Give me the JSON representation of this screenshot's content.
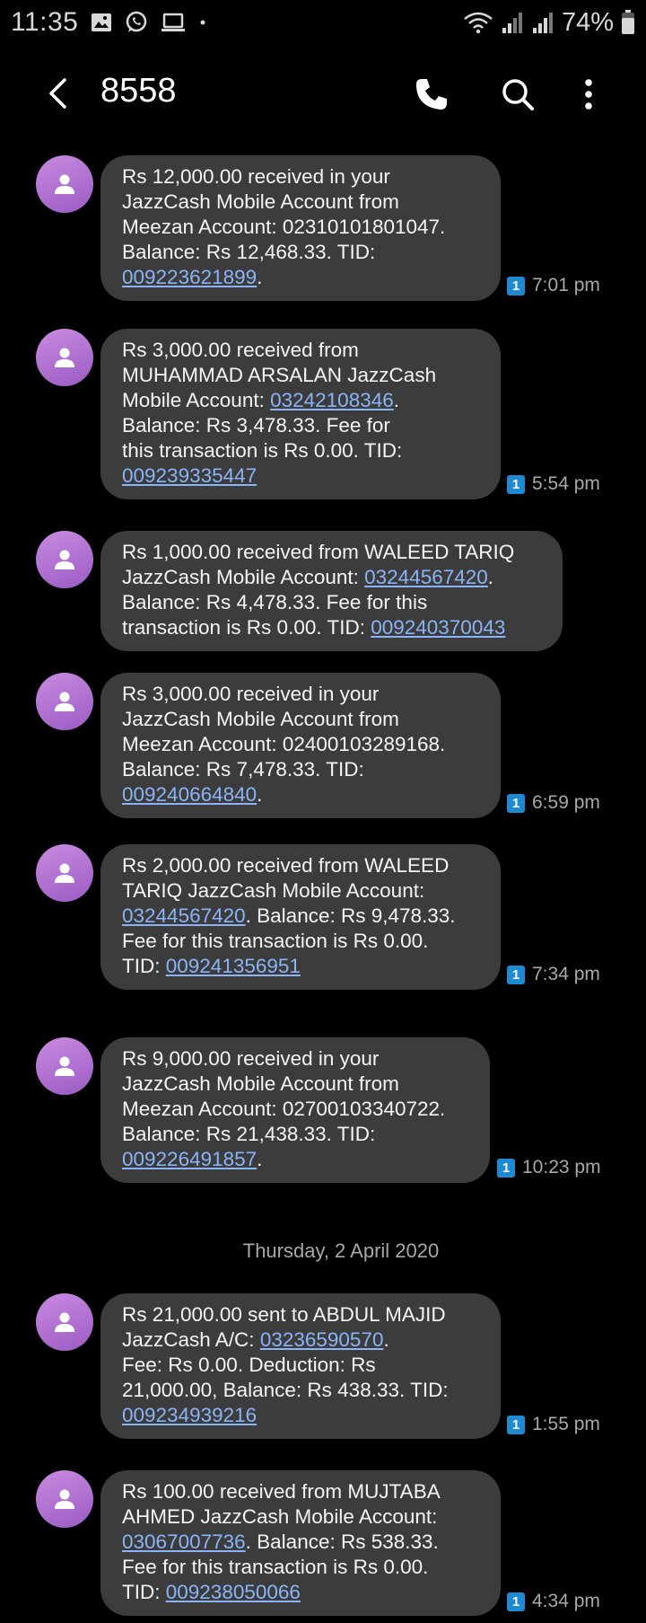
{
  "status_bar": {
    "time": "11:35",
    "battery": "74%",
    "notification_icons": [
      "image-icon",
      "whatsapp-icon",
      "laptop-icon",
      "dot-icon"
    ]
  },
  "header": {
    "title": "8558",
    "actions": [
      "back-icon",
      "phone-icon",
      "search-icon",
      "more-icon"
    ]
  },
  "sim_label": "1",
  "messages": [
    {
      "lines": [
        [
          {
            "t": "Rs 12,000.00 received in your"
          }
        ],
        [
          {
            "t": "JazzCash Mobile Account from"
          }
        ],
        [
          {
            "t": "Meezan Account: 02310101801047."
          }
        ],
        [
          {
            "t": "Balance: Rs 12,468.33. TID:"
          }
        ],
        [
          {
            "t": "009223621899",
            "link": true
          },
          {
            "t": "."
          }
        ]
      ],
      "time": "7:01 pm"
    },
    {
      "lines": [
        [
          {
            "t": "Rs 3,000.00 received from"
          }
        ],
        [
          {
            "t": "MUHAMMAD ARSALAN JazzCash"
          }
        ],
        [
          {
            "t": "Mobile Account: "
          },
          {
            "t": "03242108346",
            "link": true
          },
          {
            "t": "."
          }
        ],
        [
          {
            "t": "Balance: Rs 3,478.33. Fee for"
          }
        ],
        [
          {
            "t": "this transaction is Rs 0.00.  TID:"
          }
        ],
        [
          {
            "t": "009239335447",
            "link": true
          }
        ]
      ],
      "time": "5:54 pm"
    },
    {
      "lines": [
        [
          {
            "t": "Rs 1,000.00 received from WALEED TARIQ"
          }
        ],
        [
          {
            "t": "JazzCash Mobile Account: "
          },
          {
            "t": "03244567420",
            "link": true
          },
          {
            "t": "."
          }
        ],
        [
          {
            "t": "Balance: Rs 4,478.33. Fee for this"
          }
        ],
        [
          {
            "t": "transaction is Rs 0.00.  TID: "
          },
          {
            "t": "009240370043",
            "link": true
          }
        ]
      ],
      "time": ""
    },
    {
      "lines": [
        [
          {
            "t": "Rs 3,000.00 received in your"
          }
        ],
        [
          {
            "t": "JazzCash Mobile Account from"
          }
        ],
        [
          {
            "t": "Meezan Account: 02400103289168."
          }
        ],
        [
          {
            "t": "Balance: Rs 7,478.33. TID:"
          }
        ],
        [
          {
            "t": "009240664840",
            "link": true
          },
          {
            "t": "."
          }
        ]
      ],
      "time": "6:59 pm"
    },
    {
      "lines": [
        [
          {
            "t": "Rs 2,000.00 received from WALEED"
          }
        ],
        [
          {
            "t": "TARIQ JazzCash Mobile Account:"
          }
        ],
        [
          {
            "t": "03244567420",
            "link": true
          },
          {
            "t": ". Balance: Rs 9,478.33."
          }
        ],
        [
          {
            "t": "Fee for this transaction is Rs 0.00."
          }
        ],
        [
          {
            "t": "TID: "
          },
          {
            "t": "009241356951",
            "link": true
          }
        ]
      ],
      "time": "7:34 pm"
    },
    {
      "lines": [
        [
          {
            "t": "Rs 9,000.00 received in your"
          }
        ],
        [
          {
            "t": "JazzCash Mobile Account from"
          }
        ],
        [
          {
            "t": "Meezan Account: 02700103340722."
          }
        ],
        [
          {
            "t": "Balance: Rs 21,438.33. TID:"
          }
        ],
        [
          {
            "t": "009226491857",
            "link": true
          },
          {
            "t": "."
          }
        ]
      ],
      "time": "10:23 pm"
    },
    {
      "lines": [
        [
          {
            "t": "Rs 21,000.00 sent to ABDUL MAJID"
          }
        ],
        [
          {
            "t": "JazzCash A/C: "
          },
          {
            "t": "03236590570",
            "link": true
          },
          {
            "t": "."
          }
        ],
        [
          {
            "t": "Fee: Rs 0.00. Deduction: Rs"
          }
        ],
        [
          {
            "t": "21,000.00, Balance: Rs 438.33. TID:"
          }
        ],
        [
          {
            "t": "009234939216",
            "link": true
          }
        ]
      ],
      "time": "1:55 pm"
    },
    {
      "lines": [
        [
          {
            "t": "Rs 100.00 received from MUJTABA"
          }
        ],
        [
          {
            "t": "AHMED JazzCash Mobile Account:"
          }
        ],
        [
          {
            "t": "03067007736",
            "link": true
          },
          {
            "t": ". Balance: Rs 538.33."
          }
        ],
        [
          {
            "t": "Fee for this transaction is Rs 0.00."
          }
        ],
        [
          {
            "t": "TID: "
          },
          {
            "t": "009238050066",
            "link": true
          }
        ]
      ],
      "time": "4:34 pm"
    }
  ],
  "date_separator": "Thursday, 2 April 2020",
  "colors": {
    "background": "#000000",
    "bubble": "#3c3c3c",
    "link": "#8ab4f8",
    "avatar": "#b478d6",
    "sim_badge": "#1e8ad2"
  }
}
